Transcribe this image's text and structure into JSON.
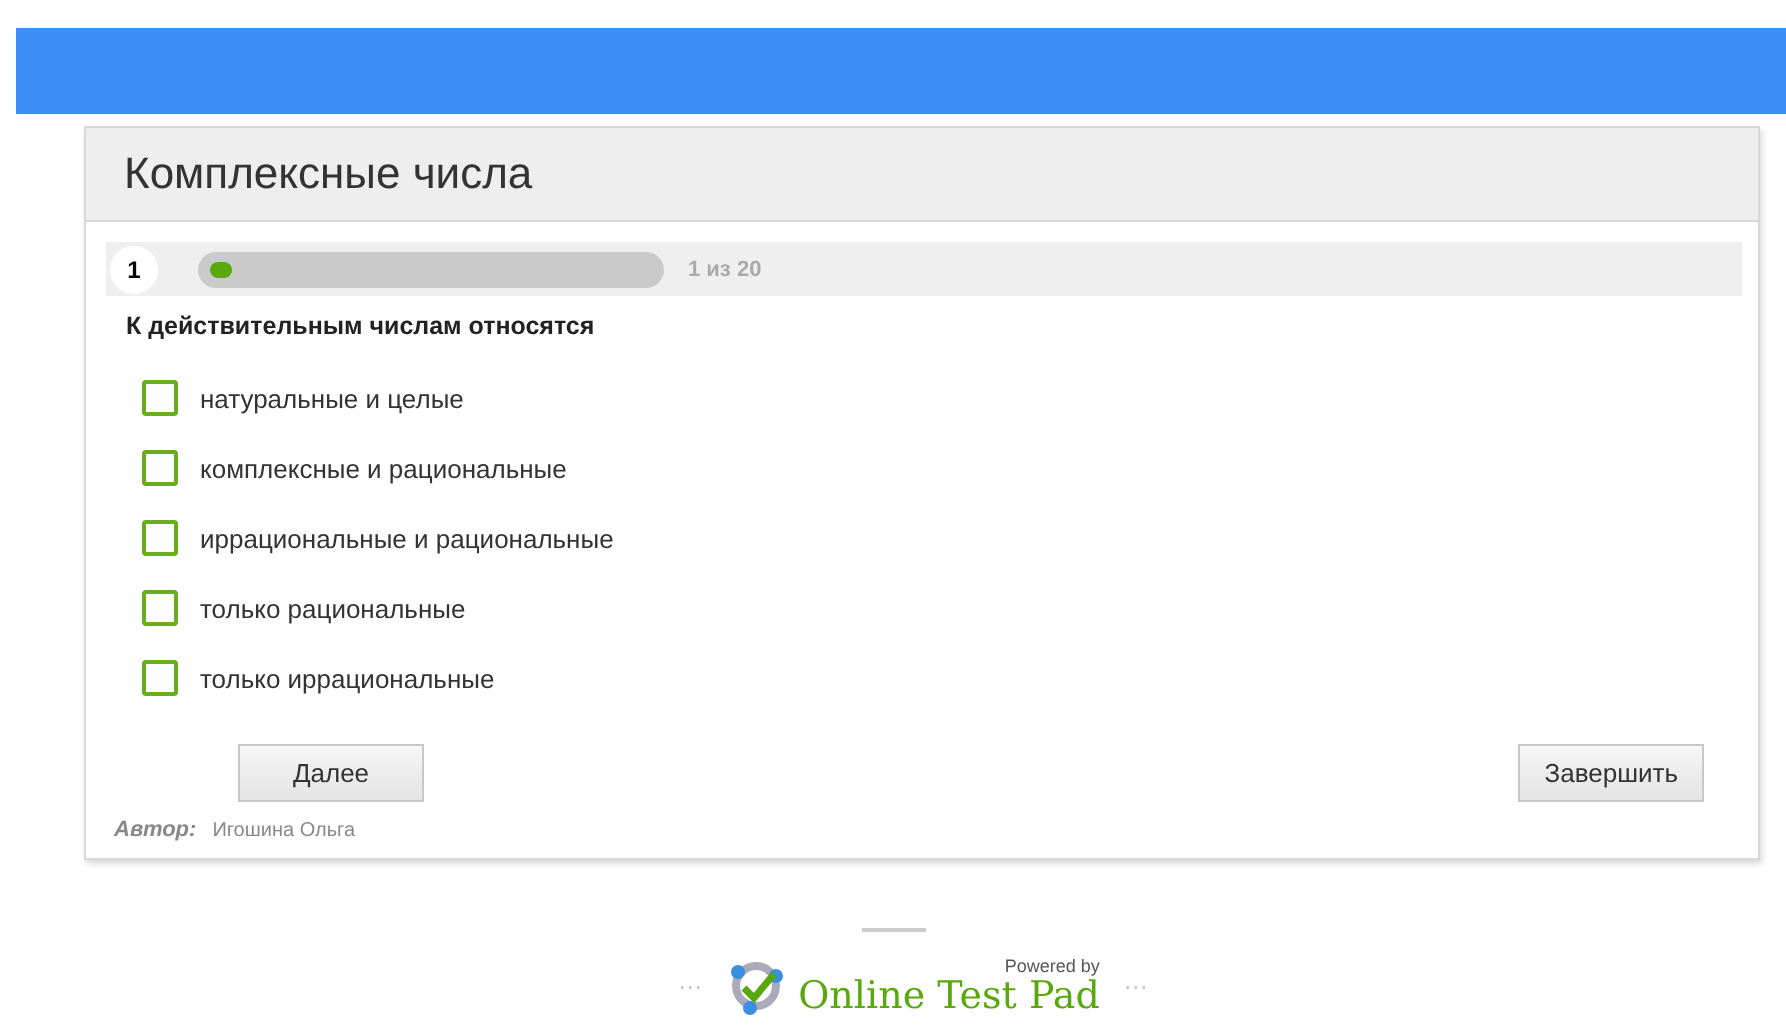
{
  "test": {
    "title": "Комплексные числа"
  },
  "progress": {
    "number": "1",
    "level": 0.05,
    "reading": "1 из 20"
  },
  "question": "К действительным числам относятся",
  "options": [
    {
      "label": "натуральные и целые",
      "checked": false
    },
    {
      "label": "комплексные и рациональные",
      "checked": false
    },
    {
      "label": "иррациональные и рациональные",
      "checked": false
    },
    {
      "label": "только рациональные",
      "checked": false
    },
    {
      "label": "только иррациональные",
      "checked": false
    }
  ],
  "buttons": {
    "next": "Далее",
    "finish": "Завершить"
  },
  "author": {
    "label": "Автор:",
    "name": "Игошина Ольга"
  },
  "footer": {
    "dots_left": "···",
    "powered": "Powered by",
    "brand": "Online Test Pad",
    "dots_right": "···"
  }
}
